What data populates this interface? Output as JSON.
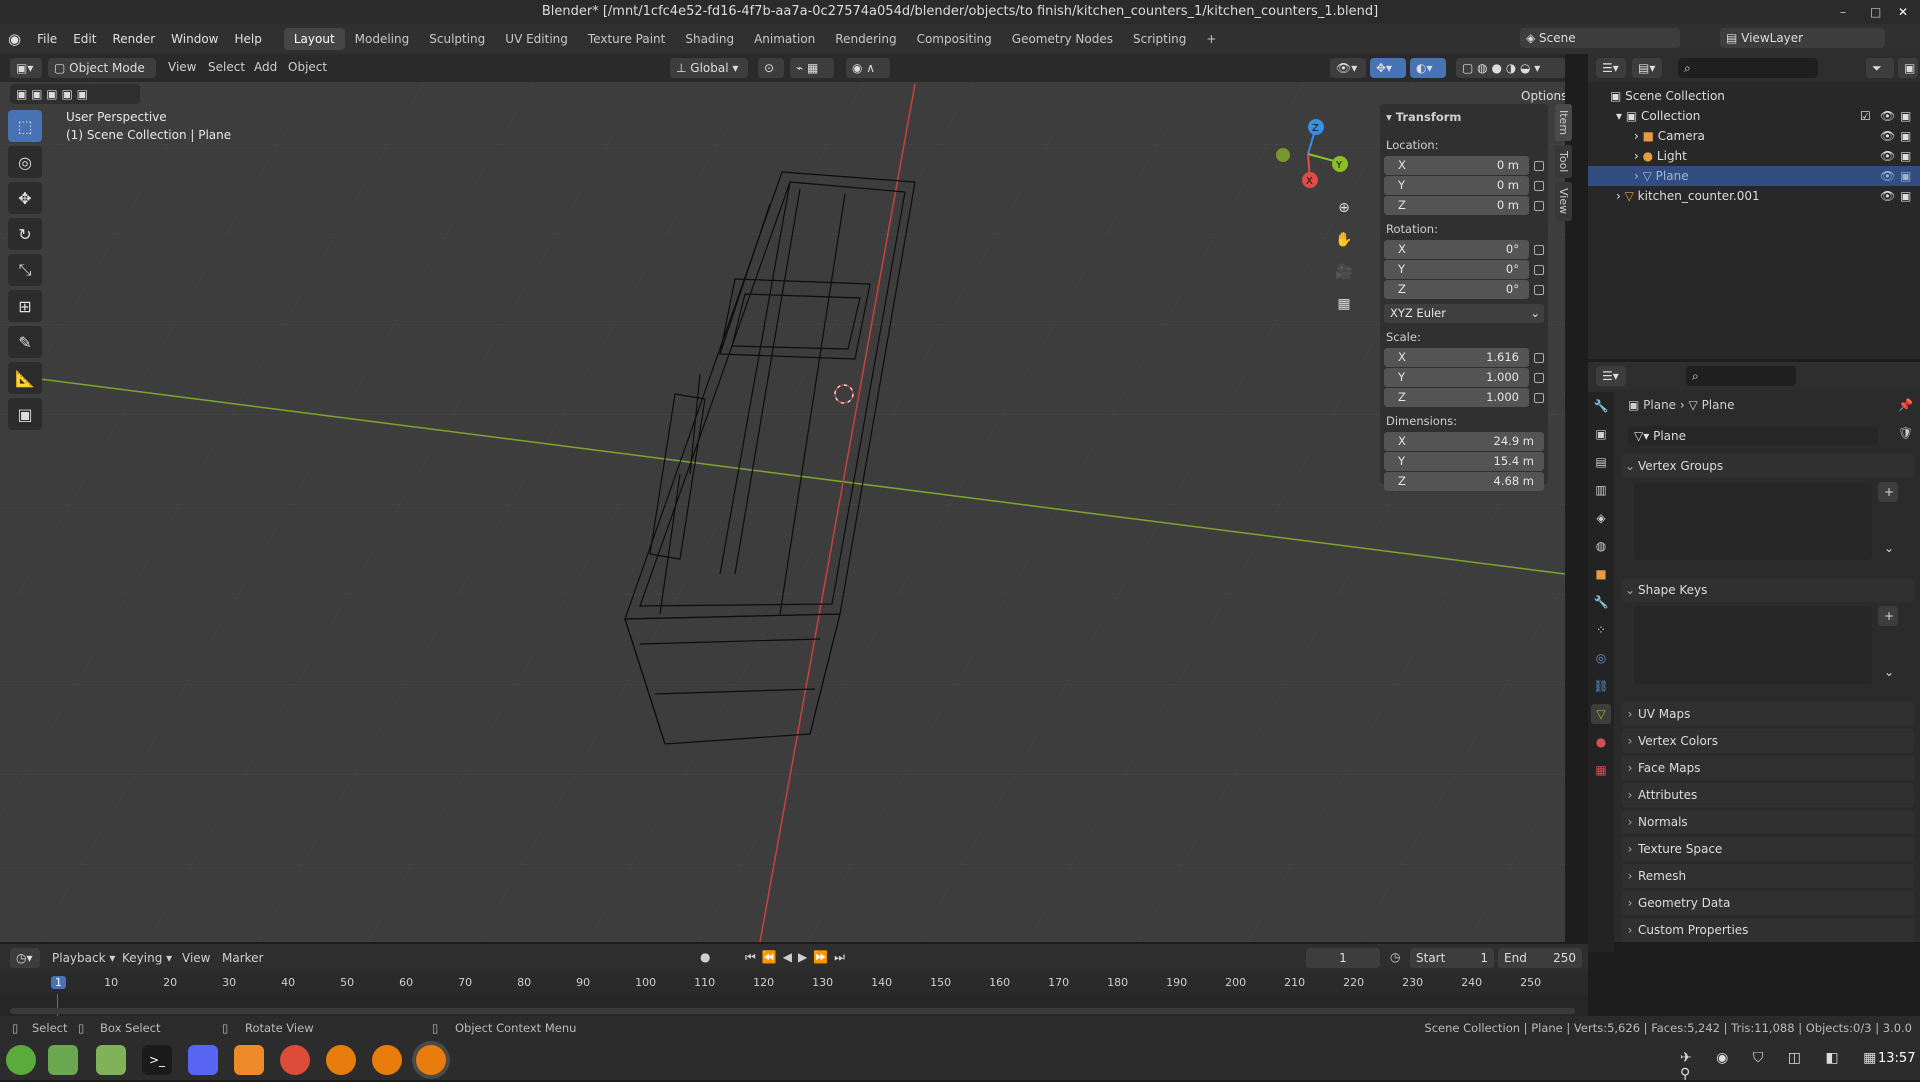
{
  "window": {
    "title": "Blender* [/mnt/1cfc4e52-fd16-4f7b-aa7a-0c27574a054d/blender/objects/to finish/kitchen_counters_1/kitchen_counters_1.blend]"
  },
  "menu": {
    "file": "File",
    "edit": "Edit",
    "render": "Render",
    "window": "Window",
    "help": "Help"
  },
  "workspaces": [
    "Layout",
    "Modeling",
    "Sculpting",
    "UV Editing",
    "Texture Paint",
    "Shading",
    "Animation",
    "Rendering",
    "Compositing",
    "Geometry Nodes",
    "Scripting"
  ],
  "workspace_add": "+",
  "scene": {
    "label": "Scene",
    "viewlayer": "ViewLayer"
  },
  "viewport_header": {
    "mode": "Object Mode",
    "view": "View",
    "select": "Select",
    "add": "Add",
    "object": "Object",
    "orientation": "Global",
    "options": "Options"
  },
  "viewport": {
    "perspective": "User Perspective",
    "collection_info": "(1) Scene Collection | Plane"
  },
  "npanel": {
    "section": "Transform",
    "location_label": "Location:",
    "location": [
      {
        "axis": "X",
        "value": "0 m"
      },
      {
        "axis": "Y",
        "value": "0 m"
      },
      {
        "axis": "Z",
        "value": "0 m"
      }
    ],
    "rotation_label": "Rotation:",
    "rotation": [
      {
        "axis": "X",
        "value": "0°"
      },
      {
        "axis": "Y",
        "value": "0°"
      },
      {
        "axis": "Z",
        "value": "0°"
      }
    ],
    "rotation_mode": "XYZ Euler",
    "scale_label": "Scale:",
    "scale": [
      {
        "axis": "X",
        "value": "1.616"
      },
      {
        "axis": "Y",
        "value": "1.000"
      },
      {
        "axis": "Z",
        "value": "1.000"
      }
    ],
    "dimensions_label": "Dimensions:",
    "dimensions": [
      {
        "axis": "X",
        "value": "24.9 m"
      },
      {
        "axis": "Y",
        "value": "15.4 m"
      },
      {
        "axis": "Z",
        "value": "4.68 m"
      }
    ],
    "tabs": [
      "Item",
      "Tool",
      "View"
    ]
  },
  "outliner": {
    "items": [
      "Scene Collection",
      "Collection",
      "Camera",
      "Light",
      "Plane",
      "kitchen_counter.001"
    ]
  },
  "properties": {
    "breadcrumb_object": "Plane",
    "breadcrumb_data": "Plane",
    "data_name": "Plane",
    "sections": [
      "Vertex Groups",
      "Shape Keys",
      "UV Maps",
      "Vertex Colors",
      "Face Maps",
      "Attributes",
      "Normals",
      "Texture Space",
      "Remesh",
      "Geometry Data",
      "Custom Properties"
    ]
  },
  "timeline": {
    "playback": "Playback",
    "keying": "Keying",
    "view": "View",
    "marker": "Marker",
    "current_frame": "1",
    "start_label": "Start",
    "start": "1",
    "end_label": "End",
    "end": "250",
    "ticks": [
      "1",
      "10",
      "20",
      "30",
      "40",
      "50",
      "60",
      "70",
      "80",
      "90",
      "100",
      "110",
      "120",
      "130",
      "140",
      "150",
      "160",
      "170",
      "180",
      "190",
      "200",
      "210",
      "220",
      "230",
      "240",
      "250"
    ]
  },
  "statusbar": {
    "select": "Select",
    "box_select": "Box Select",
    "rotate_view": "Rotate View",
    "context_menu": "Object Context Menu",
    "stats": "Scene Collection | Plane | Verts:5,626 | Faces:5,242 | Tris:11,088 | Objects:0/3 | 3.0.0"
  },
  "taskbar": {
    "time": "13:57"
  },
  "gizmo": {
    "x": "X",
    "y": "Y",
    "z": "Z"
  },
  "colors": {
    "accent": "#4772b3",
    "x_axis": "#e04b4b",
    "y_axis": "#8cbf26",
    "z_axis": "#3a8ee8"
  }
}
